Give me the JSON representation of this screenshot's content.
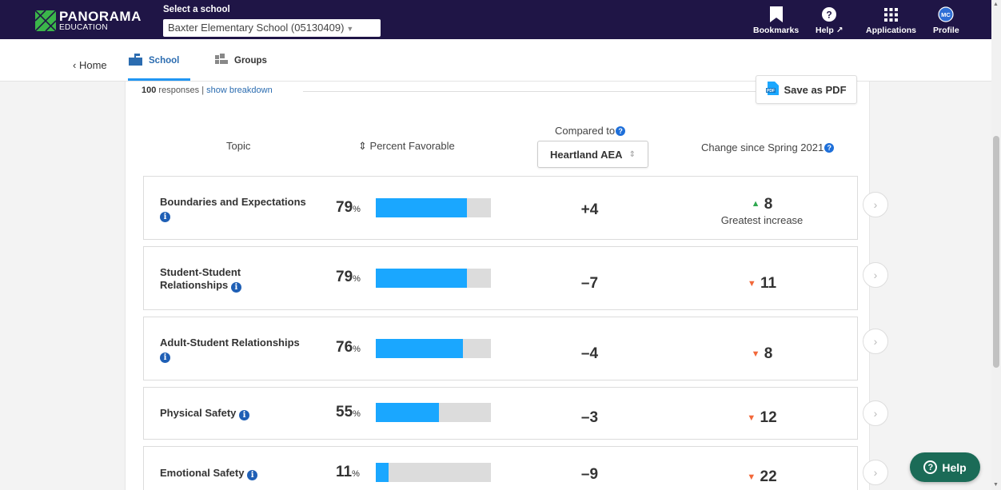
{
  "header": {
    "logo_big": "PANORAMA",
    "logo_small": "EDUCATION",
    "select_label": "Select a school",
    "school_value": "Baxter Elementary School (05130409)",
    "nav": [
      {
        "label": "Bookmarks",
        "icon": "bookmark-icon"
      },
      {
        "label": "Help",
        "icon": "help-icon"
      },
      {
        "label": "Applications",
        "icon": "apps-grid-icon"
      },
      {
        "label": "Profile",
        "icon": "avatar-icon",
        "initials": "MC"
      }
    ]
  },
  "subnav": {
    "home": "Home",
    "tabs": [
      {
        "label": "School",
        "active": true
      },
      {
        "label": "Groups",
        "active": false
      }
    ]
  },
  "report": {
    "responses_count": "100",
    "responses_text": " responses | ",
    "breakdown_link": "show breakdown",
    "pdf_label": "Save as PDF",
    "col_topic": "Topic",
    "col_percent": "Percent Favorable",
    "col_compared": "Compared to",
    "compare_value": "Heartland AEA",
    "col_change": "Change since Spring 2021",
    "rows": [
      {
        "topic": "Boundaries and Expectations",
        "percent": 79,
        "percent_text": "79",
        "compared": "+4",
        "change": "8",
        "direction": "up",
        "note": "Greatest increase"
      },
      {
        "topic": "Student-Student Relationships",
        "percent": 79,
        "percent_text": "79",
        "compared": "–7",
        "change": "11",
        "direction": "down",
        "note": ""
      },
      {
        "topic": "Adult-Student Relationships",
        "percent": 76,
        "percent_text": "76",
        "compared": "–4",
        "change": "8",
        "direction": "down",
        "note": ""
      },
      {
        "topic": "Physical Safety",
        "percent": 55,
        "percent_text": "55",
        "compared": "–3",
        "change": "12",
        "direction": "down",
        "note": ""
      },
      {
        "topic": "Emotional Safety",
        "percent": 11,
        "percent_text": "11",
        "compared": "–9",
        "change": "22",
        "direction": "down",
        "note": ""
      }
    ]
  },
  "help_button": "Help",
  "colors": {
    "navbar": "#1f1546",
    "bar": "#1aa7ff",
    "up": "#2fa84f",
    "down": "#f2683a",
    "help": "#1b6b57"
  }
}
